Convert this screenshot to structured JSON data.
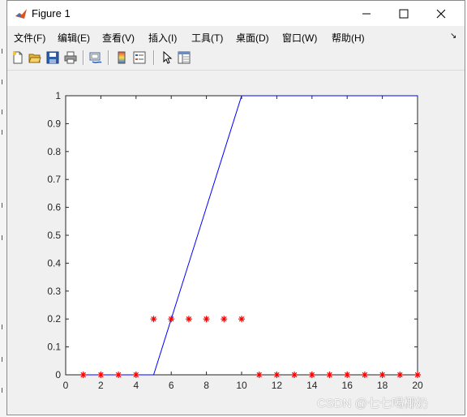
{
  "window": {
    "title": "Figure 1",
    "minimize_icon": "minimize-icon",
    "maximize_icon": "maximize-icon",
    "close_icon": "close-icon"
  },
  "menu": {
    "items": [
      "文件(F)",
      "编辑(E)",
      "查看(V)",
      "插入(I)",
      "工具(T)",
      "桌面(D)",
      "窗口(W)",
      "帮助(H)"
    ],
    "overflow_icon": "arrow-icon"
  },
  "toolbar": {
    "buttons": [
      "new-figure-icon",
      "open-file-icon",
      "save-icon",
      "print-icon",
      "link-plot-icon",
      "colorbar-icon",
      "legend-icon",
      "pointer-icon",
      "property-editor-icon"
    ]
  },
  "watermark": "CSDN @七七喝椰奶",
  "colors": {
    "line": "#0000ff",
    "marker": "#ff0000",
    "axes_bg": "#ffffff",
    "figure_bg": "#f0f0f0"
  },
  "chart_data": {
    "type": "line",
    "xlim": [
      0,
      20
    ],
    "ylim": [
      0,
      1
    ],
    "xticks": [
      0,
      2,
      4,
      6,
      8,
      10,
      12,
      14,
      16,
      18,
      20
    ],
    "yticks": [
      0,
      0.1,
      0.2,
      0.3,
      0.4,
      0.5,
      0.6,
      0.7,
      0.8,
      0.9,
      1
    ],
    "grid": false,
    "series": [
      {
        "style": "line",
        "color": "#0000ff",
        "x": [
          1,
          2,
          3,
          4,
          5,
          6,
          7,
          8,
          9,
          10,
          11,
          12,
          13,
          14,
          15,
          16,
          17,
          18,
          19,
          20
        ],
        "y": [
          0,
          0,
          0,
          0,
          0,
          0.2,
          0.4,
          0.6,
          0.8,
          1,
          1,
          1,
          1,
          1,
          1,
          1,
          1,
          1,
          1,
          1
        ]
      },
      {
        "style": "markers",
        "marker": "*",
        "color": "#ff0000",
        "x": [
          1,
          2,
          3,
          4,
          5,
          6,
          7,
          8,
          9,
          10,
          11,
          12,
          13,
          14,
          15,
          16,
          17,
          18,
          19,
          20
        ],
        "y": [
          0,
          0,
          0,
          0,
          0.2,
          0.2,
          0.2,
          0.2,
          0.2,
          0.2,
          0,
          0,
          0,
          0,
          0,
          0,
          0,
          0,
          0,
          0
        ]
      }
    ]
  }
}
